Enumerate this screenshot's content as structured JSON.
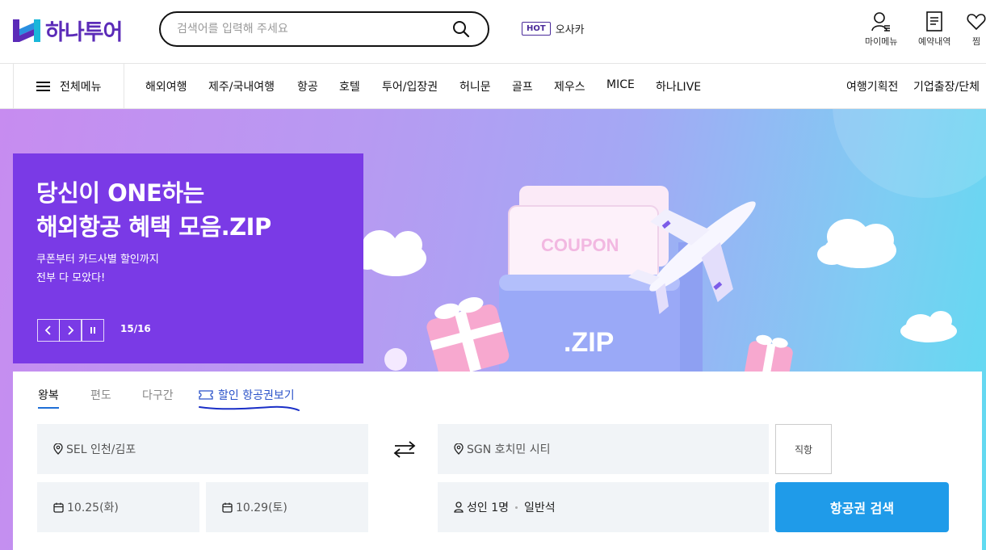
{
  "header": {
    "logo_text": "하나투어",
    "search_placeholder": "검색어를 입력해 주세요",
    "hot_badge": "HOT",
    "hot_keyword": "오사카",
    "utils": [
      "마이메뉴",
      "예약내역",
      "찜"
    ]
  },
  "gnb": {
    "all_menu_label": "전체메뉴",
    "items": [
      "해외여행",
      "제주/국내여행",
      "항공",
      "호텔",
      "투어/입장권",
      "허니문",
      "골프",
      "제우스",
      "MICE",
      "하나LIVE"
    ],
    "right_items": [
      "여행기획전",
      "기업출장/단체"
    ]
  },
  "hero": {
    "title_line1": "당신이 ONE하는",
    "title_line2": "해외항공 혜택 모음.ZIP",
    "desc_line1": "쿠폰부터 카드사별 할인까지",
    "desc_line2": "전부 다 모았다!",
    "counter": "15/16",
    "coupon_text": "COUPON",
    "zip_text": ".ZIP"
  },
  "booking": {
    "tabs": [
      "왕복",
      "편도",
      "다구간",
      "할인 항공권보기"
    ],
    "active_tab": "왕복",
    "departure": "SEL 인천/김포",
    "arrival": "SGN 호치민 시티",
    "depart_date": "10.25(화)",
    "return_date": "10.29(토)",
    "passengers": "성인 1명",
    "seat_class": "일반석",
    "direct_label": "직항",
    "search_label": "항공권 검색"
  },
  "colors": {
    "brand": "#5b2bb8",
    "promo_bg": "#7a3ae6",
    "search_button": "#1f9be9",
    "coupon_tab": "#2a52c9"
  }
}
